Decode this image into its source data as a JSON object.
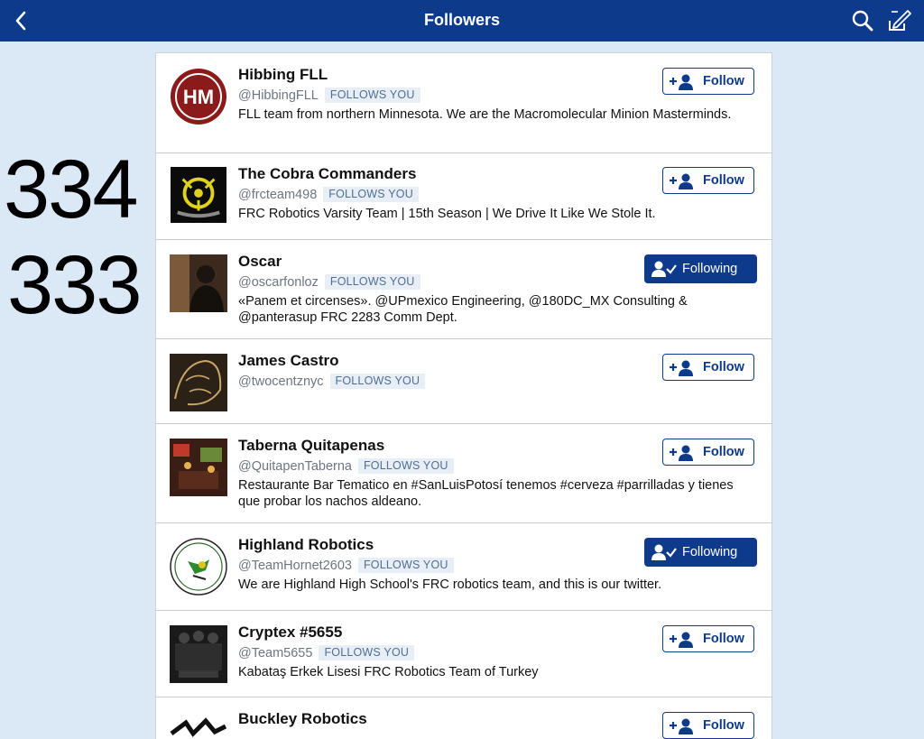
{
  "header": {
    "title": "Followers",
    "back_icon": "chevron-left-icon",
    "search_icon": "search-icon",
    "compose_icon": "compose-tweet-icon"
  },
  "colors": {
    "accent": "#0e3a8c",
    "background": "#dbe9f7",
    "badge_bg": "#e8eef5"
  },
  "overlay": {
    "top_number": "334",
    "bottom_number": "333"
  },
  "followers": [
    {
      "name": "Hibbing FLL",
      "handle": "@HibbingFLL",
      "badge": "FOLLOWS YOU",
      "bio": "FLL team from northern Minnesota. We are the Macromolecular Minion Masterminds.",
      "button": "Follow",
      "following": false
    },
    {
      "name": "The Cobra Commanders",
      "handle": "@frcteam498",
      "badge": "FOLLOWS YOU",
      "bio": "FRC Robotics Varsity Team | 15th Season | We Drive It Like We Stole It.",
      "button": "Follow",
      "following": false
    },
    {
      "name": "Oscar",
      "handle": "@oscarfonloz",
      "badge": "FOLLOWS YOU",
      "bio": "«Panem et circenses». @UPmexico Engineering, @180DC_MX Consulting & @panterasup FRC 2283 Comm Dept.",
      "button": "Following",
      "following": true
    },
    {
      "name": "James Castro",
      "handle": "@twocentznyc",
      "badge": "FOLLOWS YOU",
      "bio": "",
      "button": "Follow",
      "following": false
    },
    {
      "name": "Taberna Quitapenas",
      "handle": "@QuitapenTaberna",
      "badge": "FOLLOWS YOU",
      "bio": "Restaurante Bar Tematico en #SanLuisPotosí tenemos #cerveza #parrilladas y tienes que probar los nachos aldeano.",
      "button": "Follow",
      "following": false
    },
    {
      "name": "Highland Robotics",
      "handle": "@TeamHornet2603",
      "badge": "FOLLOWS YOU",
      "bio": "We are Highland High School's FRC robotics team, and this is our twitter.",
      "button": "Following",
      "following": true
    },
    {
      "name": "Cryptex #5655",
      "handle": "@Team5655",
      "badge": "FOLLOWS YOU",
      "bio": "Kabataş Erkek Lisesi FRC Robotics Team of Turkey",
      "button": "Follow",
      "following": false
    },
    {
      "name": "Buckley Robotics",
      "handle": "",
      "badge": "",
      "bio": "",
      "button": "Follow",
      "following": false
    }
  ]
}
